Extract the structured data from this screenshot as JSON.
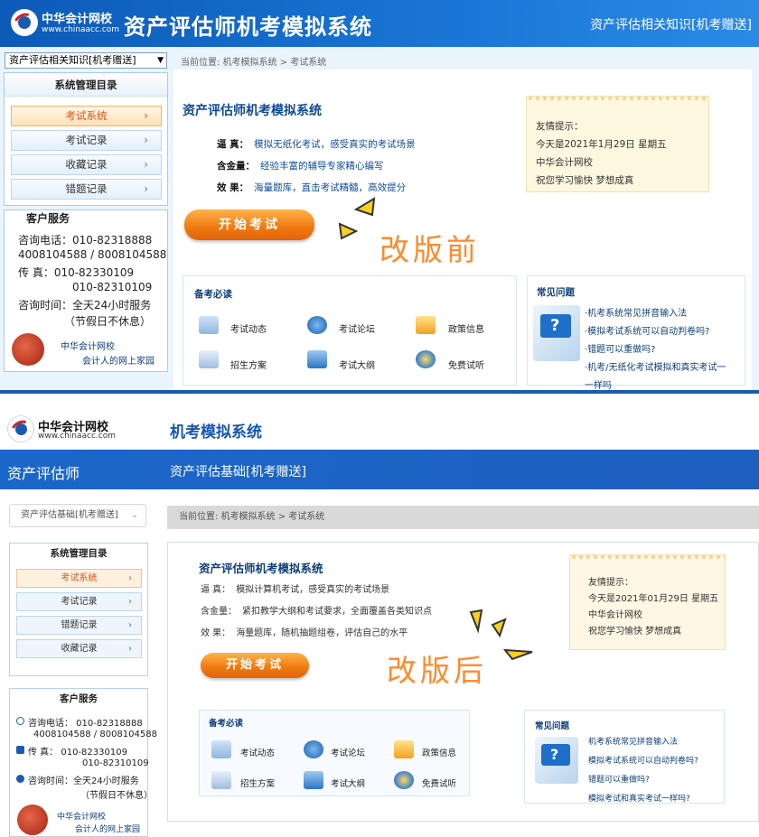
{
  "before": {
    "brand": {
      "name": "中华会计网校",
      "url": "www.chinaacc.com"
    },
    "banner_title": "资产评估师机考模拟系统",
    "banner_right": "资产评估相关知识[机考赠送]",
    "selector_value": "资产评估相关知识[机考赠送]",
    "breadcrumb": "当前位置:  机考模拟系统 > 考试系统",
    "menu": {
      "title": "系统管理目录",
      "items": [
        {
          "label": "考试系统",
          "active": true
        },
        {
          "label": "考试记录",
          "active": false
        },
        {
          "label": "收藏记录",
          "active": false
        },
        {
          "label": "错题记录",
          "active": false
        }
      ]
    },
    "service": {
      "title": "客户服务",
      "lines": [
        "咨询电话：010-82318888",
        "4008104588 / 8008104588",
        "传      真：010-82330109",
        "010-82310109",
        "咨询时间：全天24小时服务",
        "（节假日不休息）"
      ],
      "footer1": "中华会计网校",
      "footer2": "会计人的网上家园"
    },
    "main_title": "资产评估师机考模拟系统",
    "features": [
      {
        "key": "逼    真：",
        "value": "模拟无纸化考试，感受真实的考试场景"
      },
      {
        "key": "含金量：",
        "value": "经验丰富的辅导专家精心编写"
      },
      {
        "key": "效    果：",
        "value": "海量题库，直击考试精髓，高效提分"
      }
    ],
    "tip": [
      "友情提示：",
      "今天是2021年1月29日 星期五",
      "中华会计网校",
      "祝您学习愉快 梦想成真"
    ],
    "start_button": "开始考试",
    "annotation": "改版前",
    "prep": {
      "title": "备考必读",
      "items": [
        "考试动态",
        "考试论坛",
        "政策信息",
        "招生方案",
        "考试大纲",
        "免费试听"
      ]
    },
    "faq": {
      "title": "常见问题",
      "items": [
        "·机考系统常见拼音输入法",
        "·模拟考试系统可以自动判卷吗?",
        "·错题可以重做吗?",
        "·机考/无纸化考试模拟和真实考试一",
        "一样吗"
      ]
    }
  },
  "after": {
    "brand": {
      "name": "中华会计网校",
      "url": "www.chinaacc.com"
    },
    "header_title": "机考模拟系统",
    "nav_left": "资产评估师",
    "nav_right": "资产评估基础[机考赠送]",
    "selector_value": "资产评估基础[机考赠送]",
    "breadcrumb": "当前位置:  机考模拟系统  >  考试系统",
    "menu": {
      "title": "系统管理目录",
      "items": [
        {
          "label": "考试系统",
          "active": true
        },
        {
          "label": "考试记录",
          "active": false
        },
        {
          "label": "错题记录",
          "active": false
        },
        {
          "label": "收藏记录",
          "active": false
        }
      ]
    },
    "service": {
      "title": "客户服务",
      "lines": [
        "咨询电话：  010-82318888",
        "4008104588 / 8008104588",
        "传      真：  010-82330109",
        "010-82310109",
        "咨询时间：全天24小时服务",
        "（节假日不休息）"
      ],
      "footer1": "中华会计网校",
      "footer2": "会计人的网上家园"
    },
    "main_title": "资产评估师机考模拟系统",
    "features": [
      {
        "key": "逼    真：",
        "value": "模拟计算机考试，感受真实的考试场景"
      },
      {
        "key": "含金量：",
        "value": "紧扣教学大纲和考试要求，全面覆盖各类知识点"
      },
      {
        "key": "效    果：",
        "value": "海量题库，随机抽题组卷，评估自己的水平"
      }
    ],
    "tip": [
      "友情提示：",
      "今天是2021年01月29日 星期五",
      "中华会计网校",
      "祝您学习愉快 梦想成真"
    ],
    "start_button": "开始考试",
    "annotation": "改版后",
    "prep": {
      "title": "备考必读",
      "items": [
        "考试动态",
        "考试论坛",
        "政策信息",
        "招生方案",
        "考试大纲",
        "免费试听"
      ]
    },
    "faq": {
      "title": "常见问题",
      "items": [
        "机考系统常见拼音输入法",
        "模拟考试系统可以自动判卷吗?",
        "错题可以重做吗?",
        "模拟考试和真实考试一样吗?"
      ]
    }
  }
}
